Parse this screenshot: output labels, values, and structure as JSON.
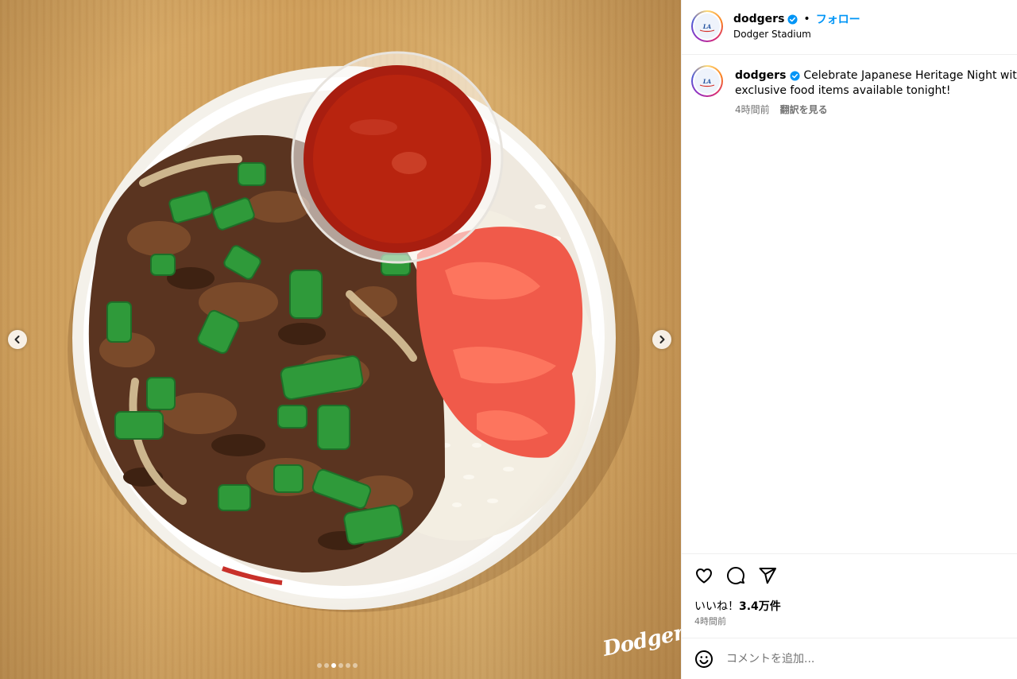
{
  "post": {
    "username": "dodgers",
    "follow_label": "フォロー",
    "separator": "•",
    "location": "Dodger Stadium",
    "caption_username": "dodgers",
    "caption_text": "Celebrate Japanese Heritage Night with the exclusive food items available tonight!",
    "caption_line1": "Celebrate Japanese Heritage Night with the",
    "caption_line2": "exclusive food items available tonight!",
    "caption_time": "4時間前",
    "translate_label": "翻訳を見る",
    "likes_prefix": "いいね！",
    "likes_count": "3.4万件",
    "post_time": "4時間前",
    "comment_placeholder": "コメントを追加..."
  },
  "media": {
    "watermark": "Dodgers",
    "carousel_total": 6,
    "carousel_active": 3
  },
  "icons": {
    "verified": "verified-badge-icon",
    "like": "heart-icon",
    "comment": "speech-bubble-icon",
    "share": "paper-plane-icon",
    "emoji": "smiley-icon",
    "prev": "chevron-left-icon",
    "next": "chevron-right-icon"
  },
  "colors": {
    "verified_blue": "#0095f6",
    "follow_blue": "#0095f6",
    "muted_text": "#737373",
    "divider": "#efefef"
  }
}
